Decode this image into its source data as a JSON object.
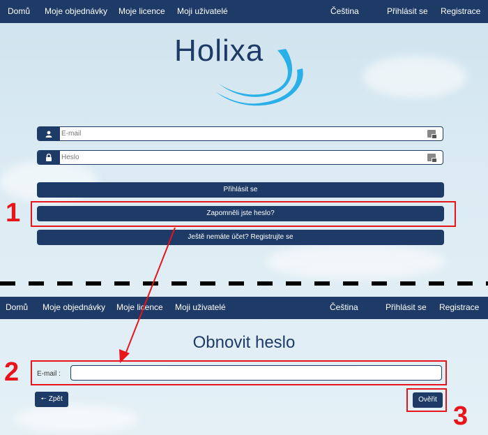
{
  "top_nav": {
    "items": [
      "Domů",
      "Moje objednávky",
      "Moje licence",
      "Moji uživatelé"
    ],
    "right": [
      "Čeština",
      "Přihlásit se",
      "Registrace"
    ]
  },
  "logo": {
    "text": "Holixa"
  },
  "login": {
    "email_placeholder": "E-mail",
    "password_placeholder": "Heslo",
    "login_button": "Přihlásit se",
    "forgot_button": "Zapomněli jste heslo?",
    "register_button": "Ještě nemáte účet? Registrujte se"
  },
  "bottom_nav": {
    "items": [
      "Domů",
      "Moje objednávky",
      "Moje licence",
      "Moji uživatelé"
    ],
    "right": [
      "Čeština",
      "Přihlásit se",
      "Registrace"
    ]
  },
  "reset": {
    "title": "Obnovit heslo",
    "email_label": "E-mail :",
    "back_button": "Zpět",
    "verify_button": "Ověřit"
  },
  "annotations": {
    "step1": "1",
    "step2": "2",
    "step3": "3",
    "color": "#e8141a"
  },
  "colors": {
    "navy": "#1e3a66",
    "accent_blue": "#29b0e8"
  }
}
